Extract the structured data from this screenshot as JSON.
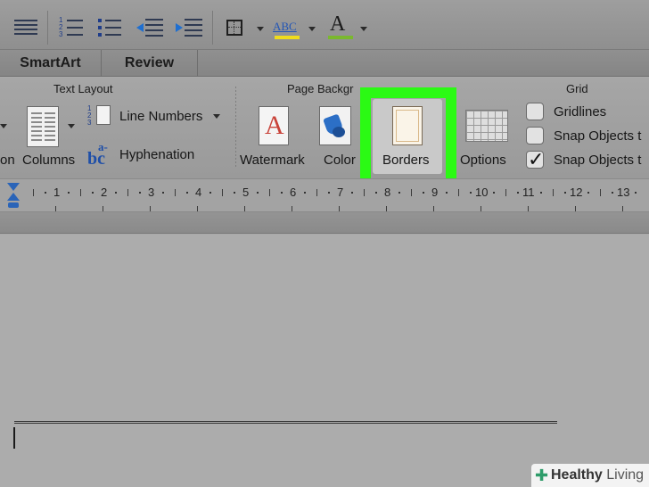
{
  "tabs": [
    {
      "label": "SmartArt"
    },
    {
      "label": "Review"
    }
  ],
  "ribbon": {
    "text_layout": {
      "title": "Text Layout",
      "orientation_partial": "on",
      "columns": "Columns",
      "line_numbers": "Line Numbers",
      "hyphenation": "Hyphenation",
      "line_numbers_glyph": "1 2 3",
      "hyphenation_glyph_top": "a-",
      "hyphenation_glyph_bottom": "bc"
    },
    "page_background": {
      "title": "Page Backgr",
      "watermark": "Watermark",
      "watermark_glyph": "A",
      "color": "Color",
      "borders": "Borders"
    },
    "grid": {
      "title": "Grid",
      "options": "Options",
      "gridlines": "Gridlines",
      "snap1": "Snap Objects t",
      "snap2": "Snap Objects t",
      "gridlines_checked": false,
      "snap1_checked": false,
      "snap2_checked": true
    }
  },
  "toolbar": {
    "spelling_glyph": "ABC",
    "font_color_glyph": "A",
    "font_color_bar": "#7ab82e",
    "highlight_bar": "#f0dc1c"
  },
  "ruler": {
    "numbers": [
      "1",
      "2",
      "3",
      "4",
      "5",
      "6",
      "7",
      "8",
      "9",
      "10",
      "11",
      "12",
      "13"
    ]
  },
  "watermark": {
    "brand_bold": "Healthy",
    "brand_rest": "Living"
  },
  "accent": {
    "highlight_color": "#2bfa14"
  }
}
